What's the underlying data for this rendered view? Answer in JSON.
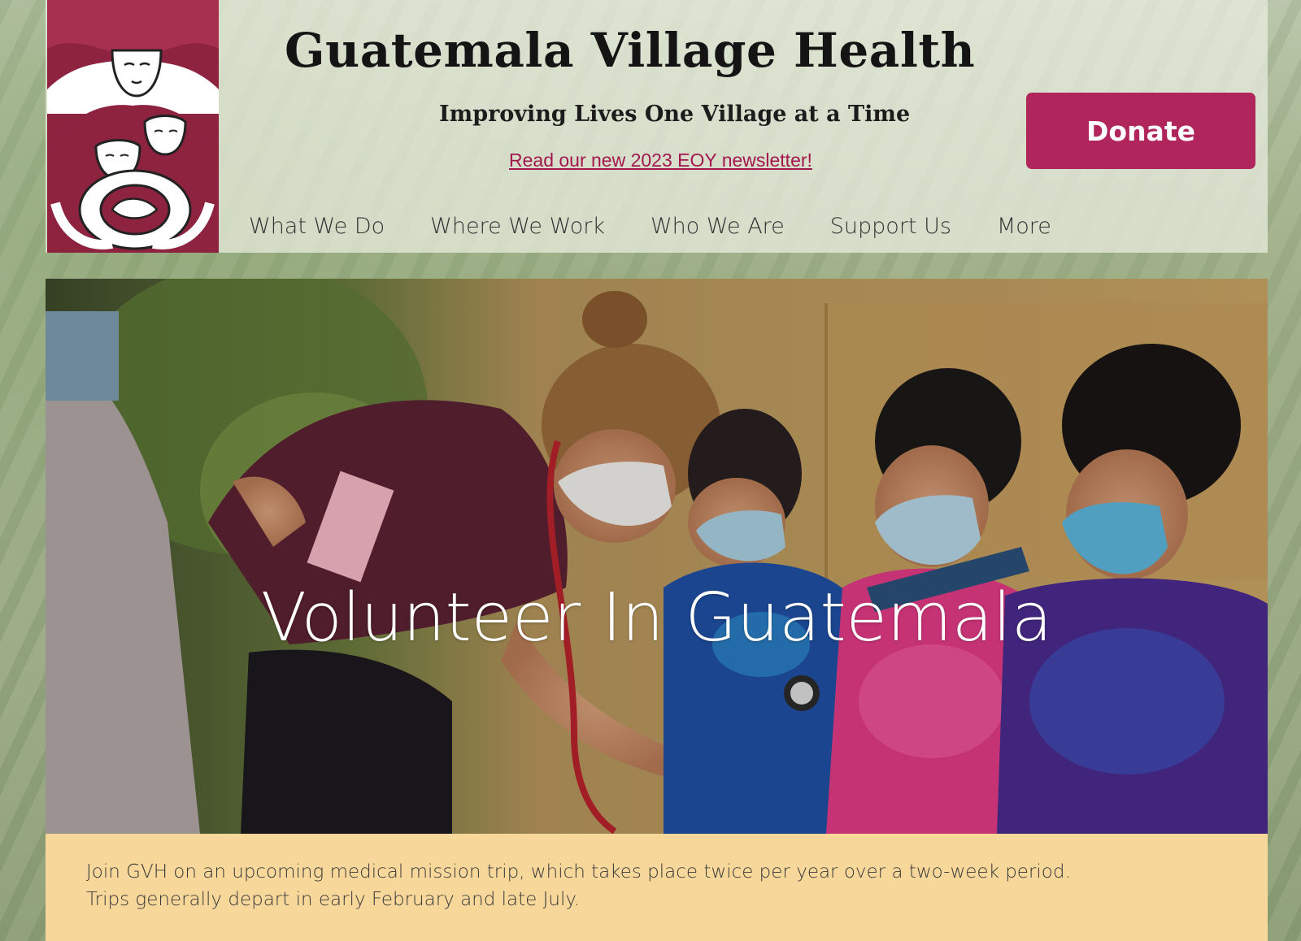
{
  "site": {
    "title": "Guatemala Village Health",
    "tagline": "Improving Lives One Village at a Time",
    "newsletter_link": "Read our new 2023 EOY newsletter!",
    "donate_label": "Donate",
    "logo_icon": "mother-and-children-logo"
  },
  "nav": {
    "items": [
      {
        "label": "What We Do"
      },
      {
        "label": "Where We Work"
      },
      {
        "label": "Who We Are"
      },
      {
        "label": "Support Us"
      },
      {
        "label": "More"
      }
    ]
  },
  "hero": {
    "title": "Volunteer In Guatemala"
  },
  "info": {
    "lines": [
      "Join GVH on an upcoming medical mission trip, which takes place twice per year over a two-week period.",
      "Trips generally depart in early February and late July."
    ]
  },
  "colors": {
    "brand": "#b0255c",
    "logo_red": "#8e2340",
    "info_band": "#f7d79a",
    "link": "#a3174f"
  }
}
